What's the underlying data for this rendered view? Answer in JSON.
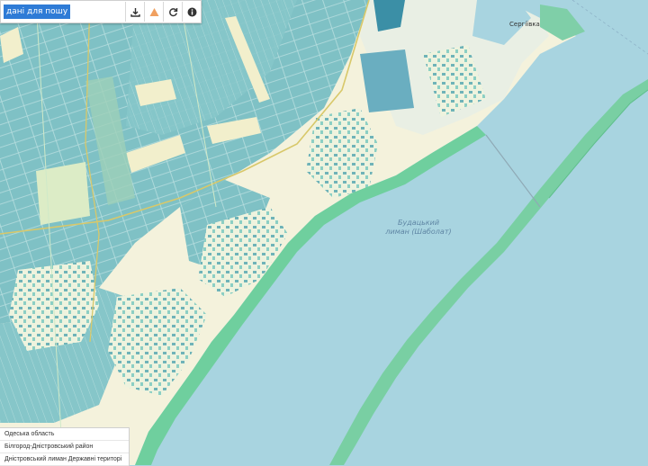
{
  "search": {
    "placeholder": "дані для пошуку"
  },
  "toolbar": {
    "buttons": [
      {
        "name": "download-button",
        "icon": "download-icon"
      },
      {
        "name": "warning-button",
        "icon": "warning-icon"
      },
      {
        "name": "refresh-button",
        "icon": "refresh-icon"
      },
      {
        "name": "info-button",
        "icon": "info-icon"
      }
    ]
  },
  "map": {
    "liman_label_line1": "Будацький",
    "liman_label_line2": "лиман (Шаболат)",
    "town_label": "Сергіївка",
    "colors": {
      "water": "#a8d4e0",
      "land": "#f4f2dc",
      "parcel": "#86c5c9",
      "parcel_dark": "#4fa3b0",
      "field_light": "#dcecc6",
      "shore": "#6fcf9e",
      "road": "#d8c86a"
    }
  },
  "info_panel": {
    "rows": [
      "Одеська область",
      "Білгород-Дністровський район",
      "Дністровський лиман Державні територі"
    ]
  }
}
